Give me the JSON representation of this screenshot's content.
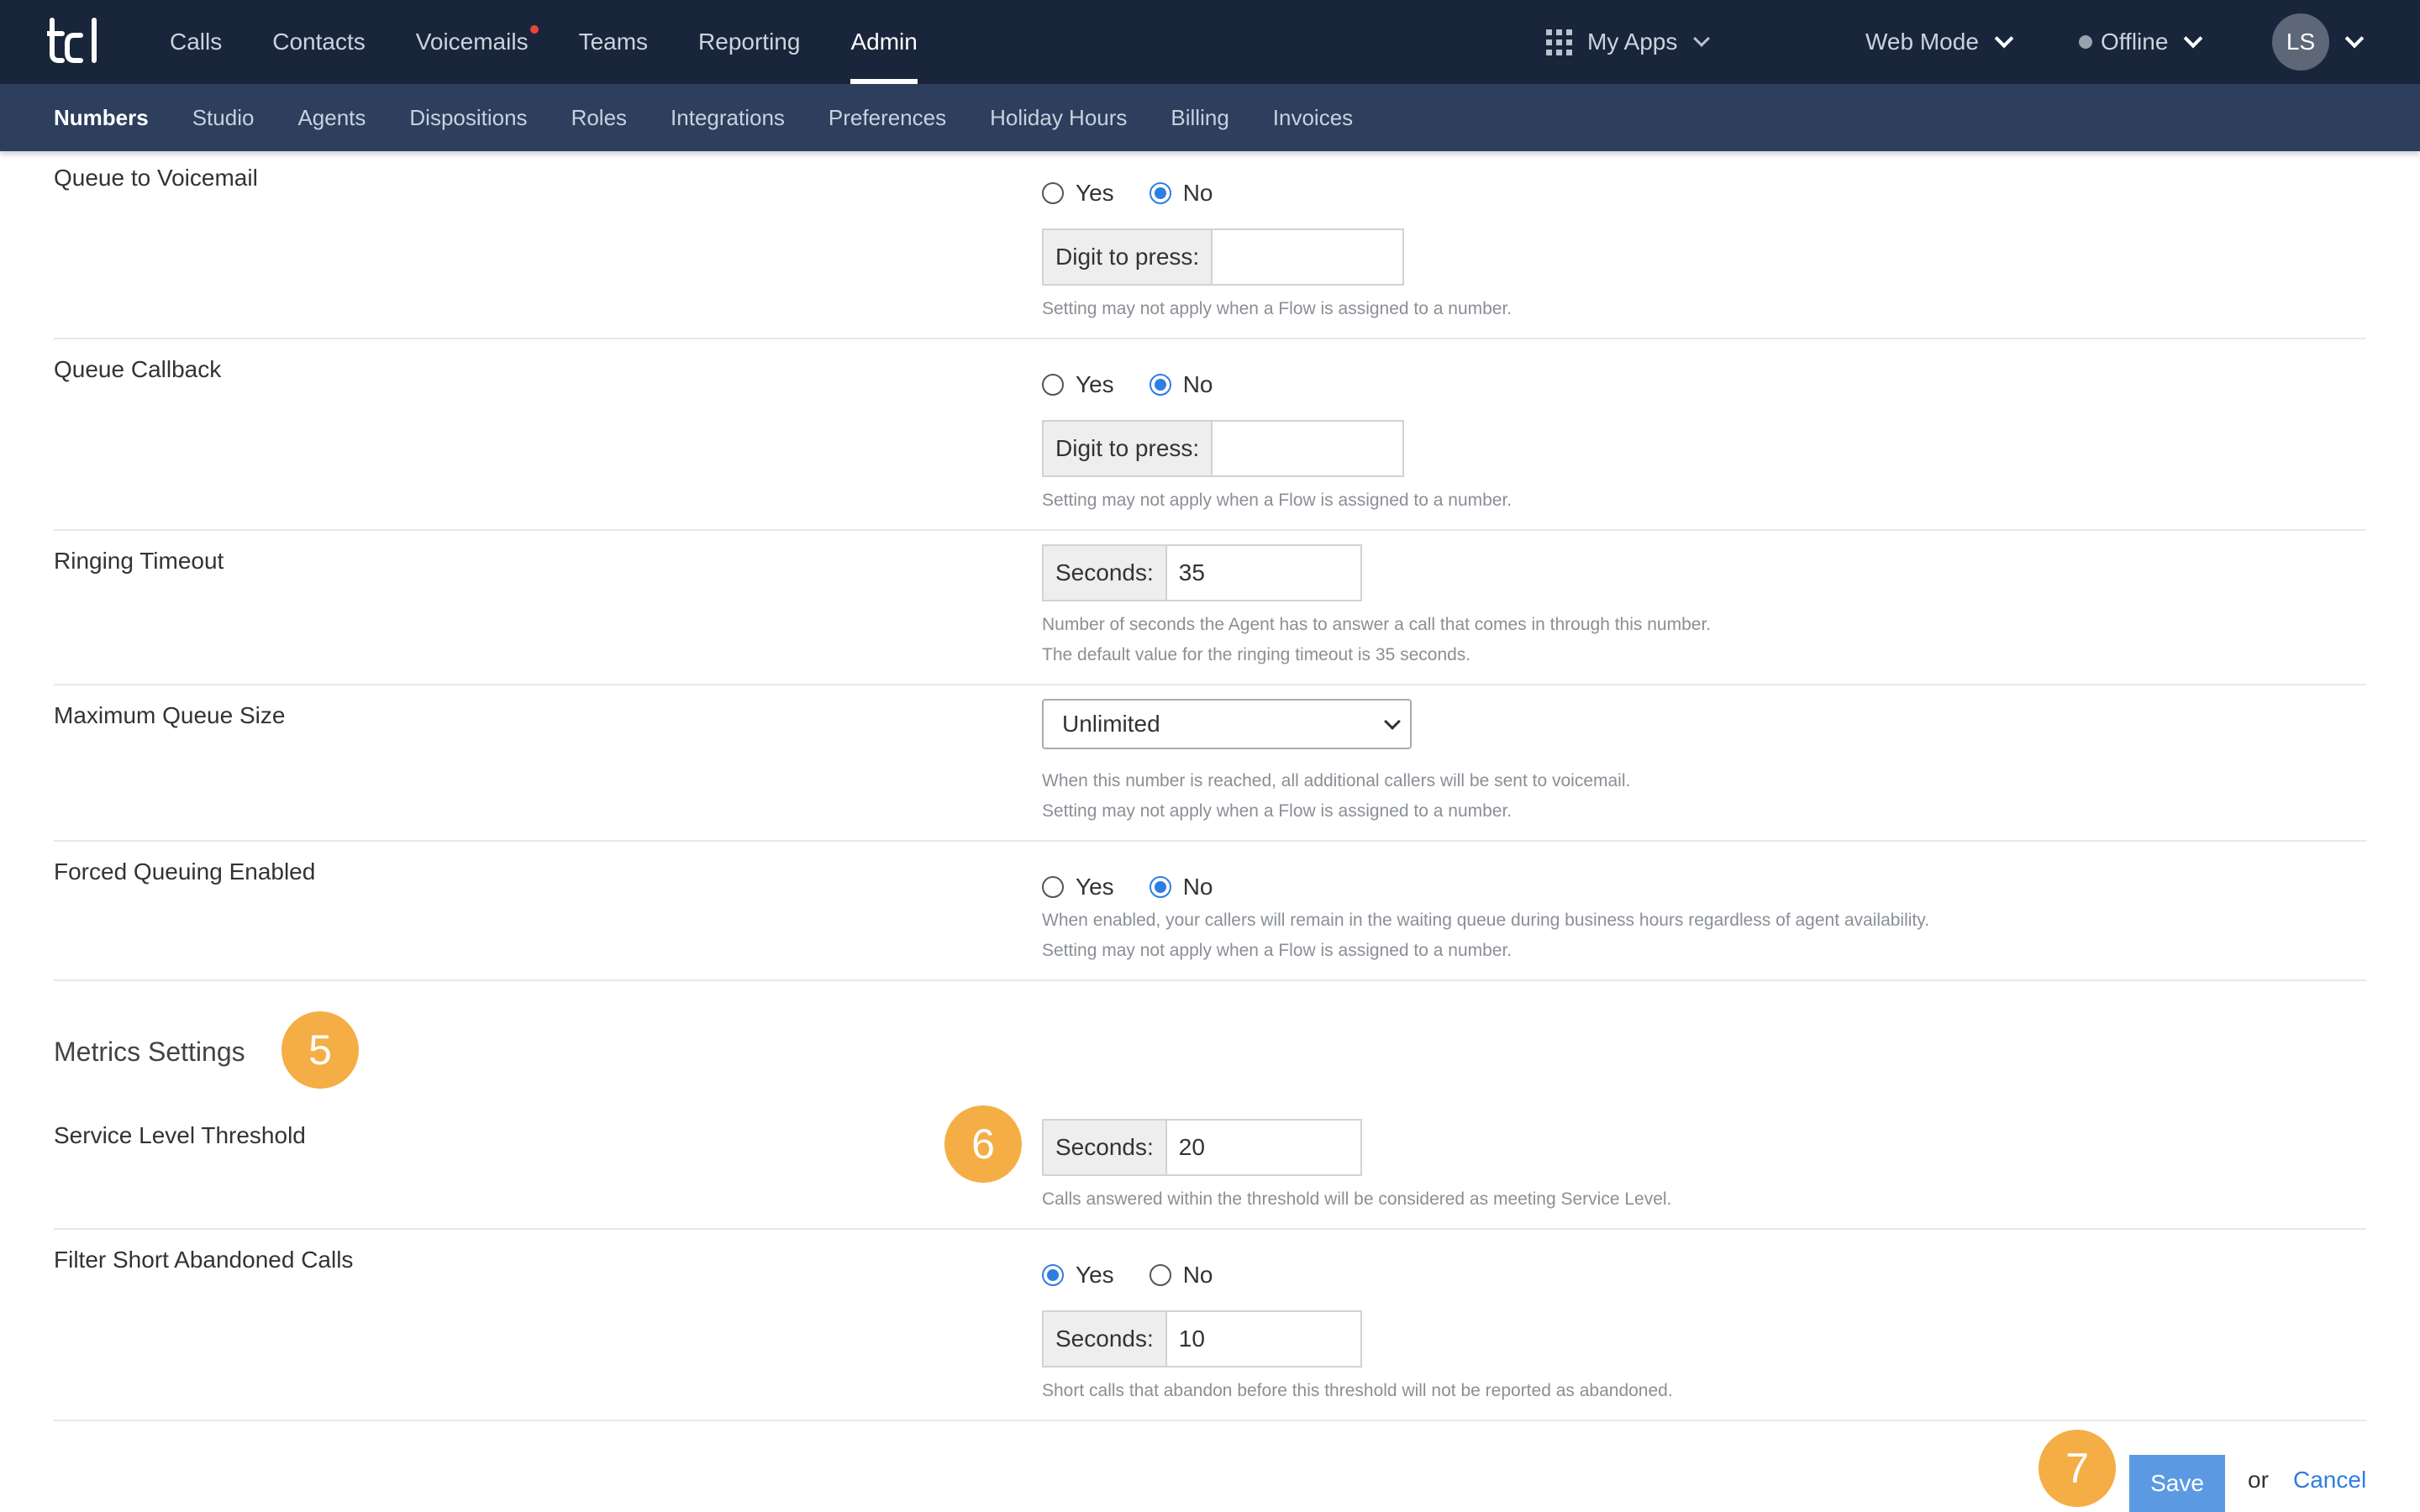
{
  "app": {
    "logo_text": "tcl"
  },
  "topnav": {
    "items": [
      {
        "label": "Calls"
      },
      {
        "label": "Contacts"
      },
      {
        "label": "Voicemails"
      },
      {
        "label": "Teams"
      },
      {
        "label": "Reporting"
      },
      {
        "label": "Admin"
      }
    ],
    "active": "Admin",
    "my_apps_label": "My Apps",
    "web_mode_label": "Web Mode",
    "status_label": "Offline",
    "avatar_initials": "LS"
  },
  "subnav": {
    "items": [
      {
        "label": "Numbers"
      },
      {
        "label": "Studio"
      },
      {
        "label": "Agents"
      },
      {
        "label": "Dispositions"
      },
      {
        "label": "Roles"
      },
      {
        "label": "Integrations"
      },
      {
        "label": "Preferences"
      },
      {
        "label": "Holiday Hours"
      },
      {
        "label": "Billing"
      },
      {
        "label": "Invoices"
      }
    ],
    "active": "Numbers"
  },
  "settings": {
    "queue_to_voicemail": {
      "label": "Queue to Voicemail",
      "yes_label": "Yes",
      "no_label": "No",
      "selected": "No",
      "digit_label": "Digit to press:",
      "digit_value": "",
      "help": "Setting may not apply when a Flow is assigned to a number."
    },
    "queue_callback": {
      "label": "Queue Callback",
      "yes_label": "Yes",
      "no_label": "No",
      "selected": "No",
      "digit_label": "Digit to press:",
      "digit_value": "",
      "help": "Setting may not apply when a Flow is assigned to a number."
    },
    "ringing_timeout": {
      "label": "Ringing Timeout",
      "seconds_label": "Seconds:",
      "seconds_value": "35",
      "help1": "Number of seconds the Agent has to answer a call that comes in through this number.",
      "help2": "The default value for the ringing timeout is 35 seconds."
    },
    "max_queue_size": {
      "label": "Maximum Queue Size",
      "selected": "Unlimited",
      "help1": "When this number is reached, all additional callers will be sent to voicemail.",
      "help2": "Setting may not apply when a Flow is assigned to a number."
    },
    "forced_queuing": {
      "label": "Forced Queuing Enabled",
      "yes_label": "Yes",
      "no_label": "No",
      "selected": "No",
      "help1": "When enabled, your callers will remain in the waiting queue during business hours regardless of agent availability.",
      "help2": "Setting may not apply when a Flow is assigned to a number."
    }
  },
  "metrics": {
    "title": "Metrics Settings",
    "service_level": {
      "label": "Service Level Threshold",
      "seconds_label": "Seconds:",
      "seconds_value": "20",
      "help": "Calls answered within the threshold will be considered as meeting Service Level."
    },
    "filter_short_abandoned": {
      "label": "Filter Short Abandoned Calls",
      "yes_label": "Yes",
      "no_label": "No",
      "selected": "Yes",
      "seconds_label": "Seconds:",
      "seconds_value": "10",
      "help": "Short calls that abandon before this threshold will not be reported as abandoned."
    }
  },
  "badges": {
    "b5": "5",
    "b6": "6",
    "b7": "7"
  },
  "actions": {
    "save_label": "Save",
    "or_label": "or",
    "cancel_label": "Cancel"
  },
  "colors": {
    "topbar": "#19253b",
    "subnav": "#2d3f5d",
    "accent": "#2f7de1",
    "badge": "#f4ae45",
    "save": "#5b9ae3"
  }
}
